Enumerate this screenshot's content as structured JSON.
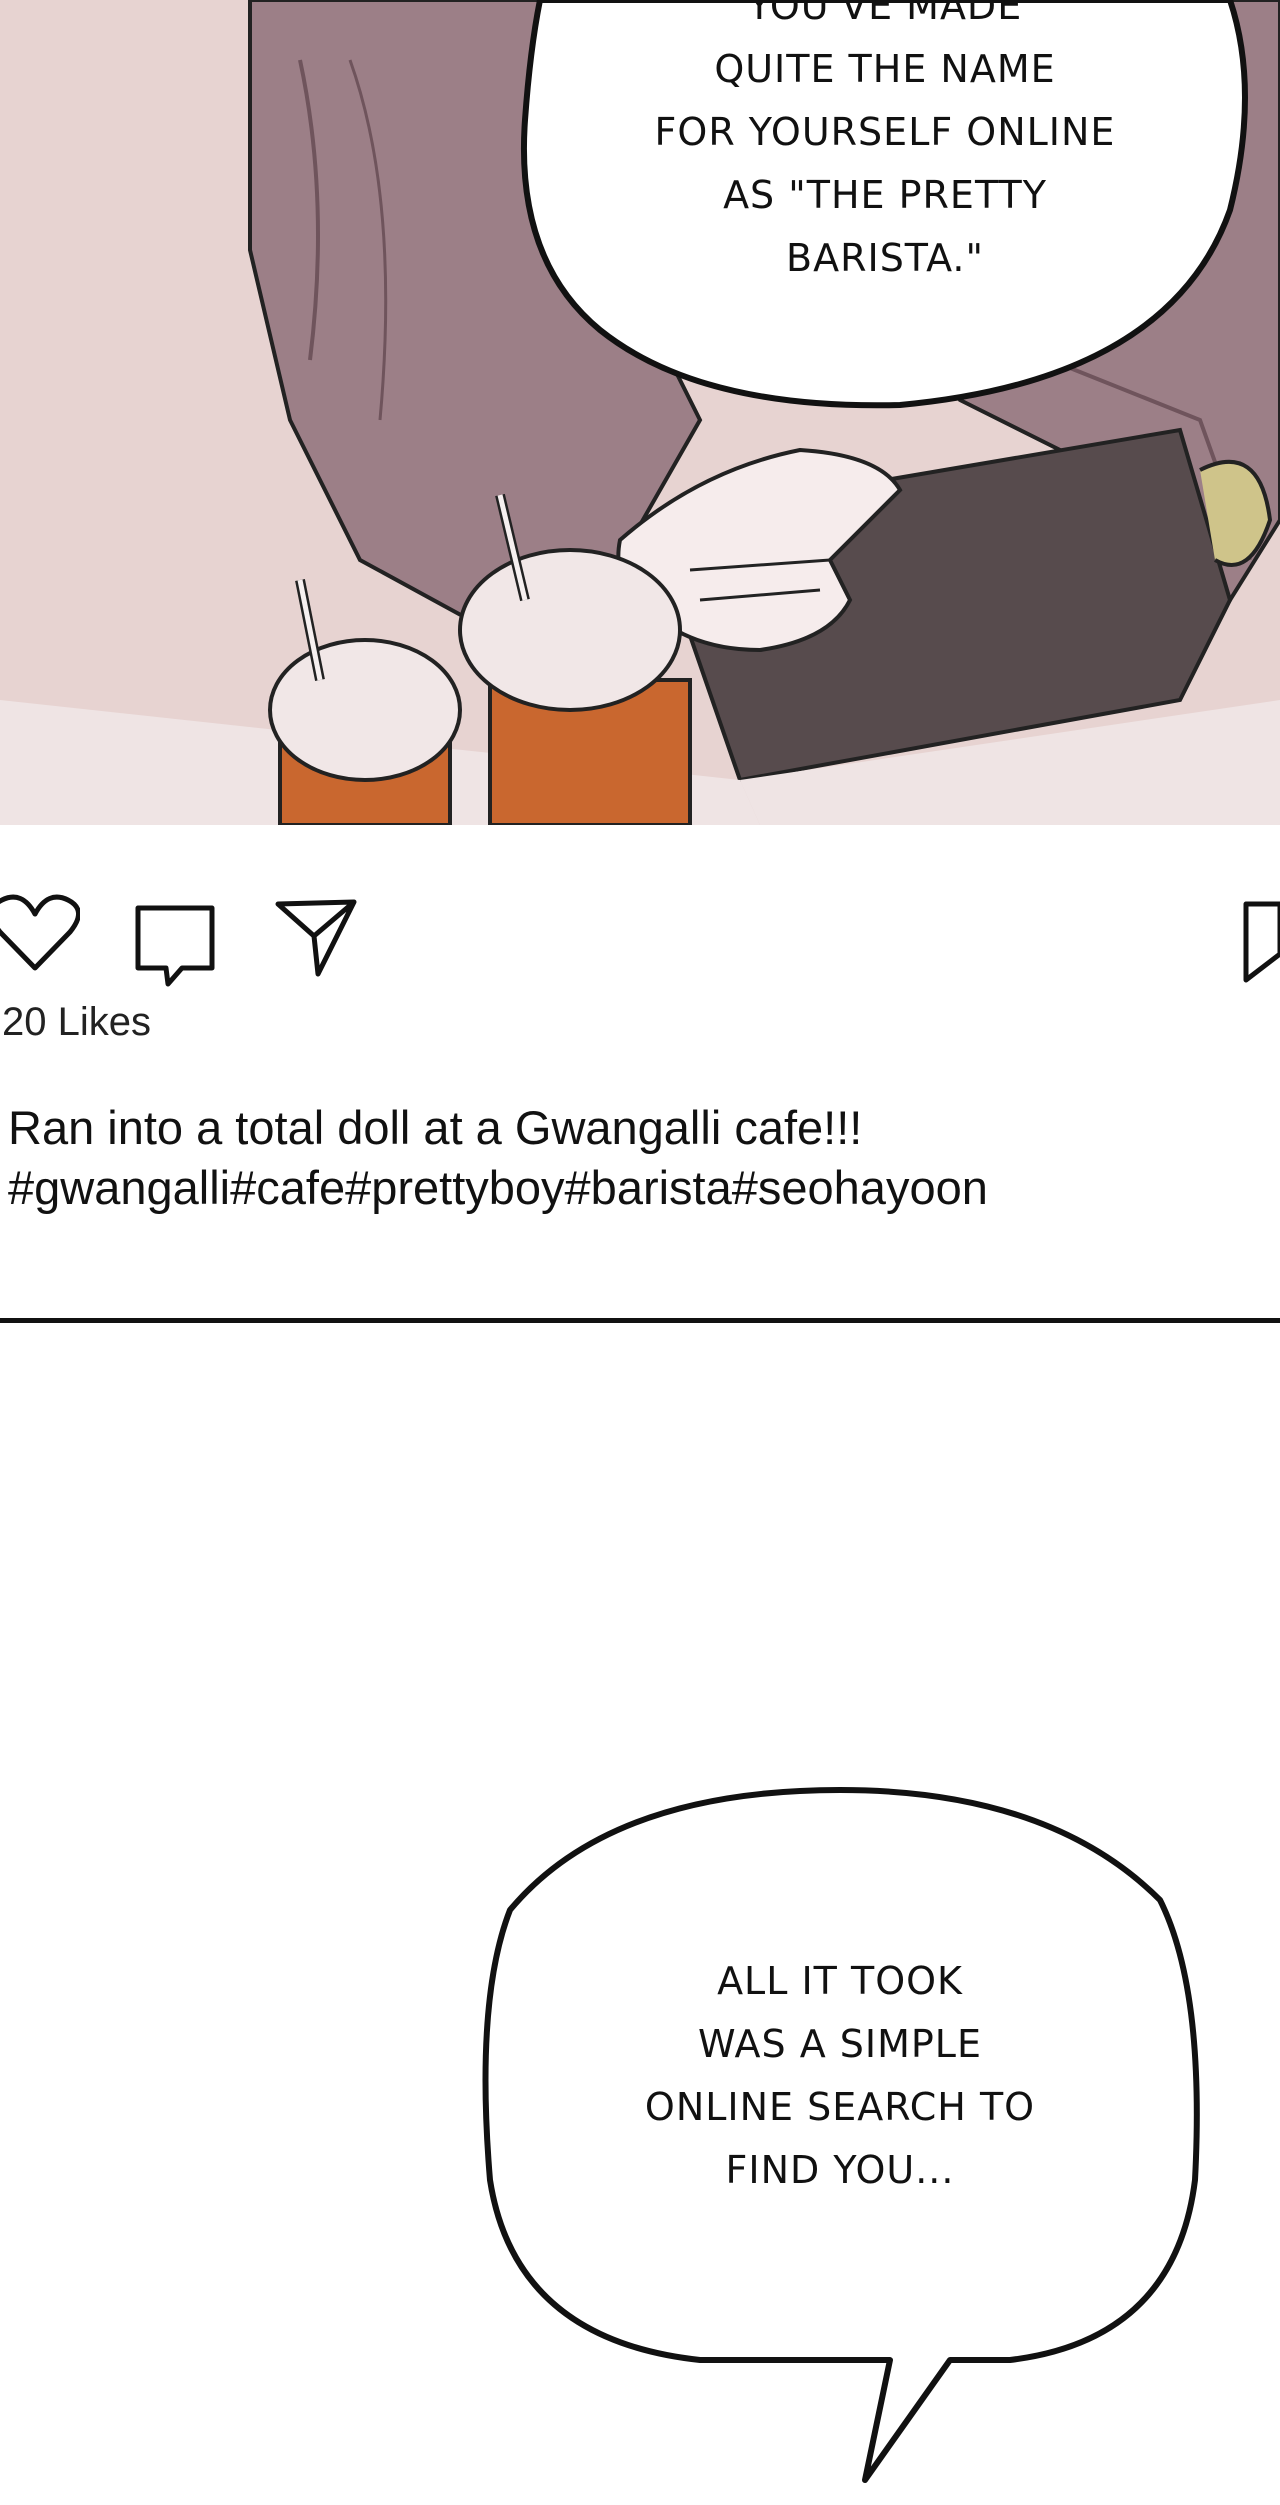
{
  "panel": {
    "speech_bubble_1": {
      "lines": [
        "YOU'VE MADE",
        "QUITE THE NAME",
        "FOR YOURSELF ONLINE",
        "AS \"THE PRETTY",
        "BARISTA.\""
      ]
    }
  },
  "post": {
    "actions": {
      "like_icon": "heart-icon",
      "comment_icon": "comment-icon",
      "share_icon": "send-icon",
      "save_icon": "bookmark-icon"
    },
    "likes": "20 Likes",
    "caption_lines": [
      "Ran into a total doll at a Gwangalli cafe!!!",
      "#gwangalli#cafe#prettyboy#barista#seohayoon"
    ]
  },
  "speech_bubble_2": {
    "lines": [
      "ALL IT TOOK",
      "WAS A SIMPLE",
      "ONLINE SEARCH TO",
      "FIND YOU..."
    ]
  }
}
